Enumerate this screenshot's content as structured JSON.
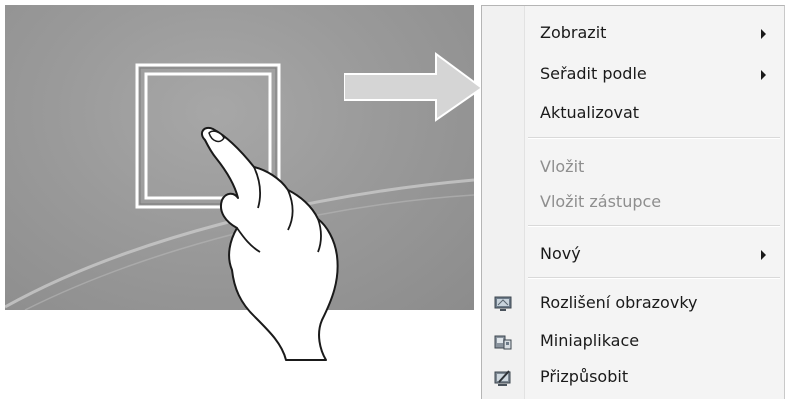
{
  "context_menu": {
    "items": [
      {
        "label": "Zobrazit",
        "submenu": true,
        "enabled": true
      },
      {
        "label": "Seřadit podle",
        "submenu": true,
        "enabled": true
      },
      {
        "label": "Aktualizovat",
        "submenu": false,
        "enabled": true
      },
      {
        "label": "Vložit",
        "submenu": false,
        "enabled": false
      },
      {
        "label": "Vložit zástupce",
        "submenu": false,
        "enabled": false
      },
      {
        "label": "Nový",
        "submenu": true,
        "enabled": true
      },
      {
        "label": "Rozlišení obrazovky",
        "submenu": false,
        "enabled": true,
        "icon": "screen-resolution-icon"
      },
      {
        "label": "Miniaplikace",
        "submenu": false,
        "enabled": true,
        "icon": "gadgets-icon"
      },
      {
        "label": "Přizpůsobit",
        "submenu": false,
        "enabled": true,
        "icon": "personalize-icon"
      }
    ]
  },
  "illustration": {
    "gesture": "press-and-hold",
    "icons": [
      "hand-pointer-icon",
      "selection-square-icon",
      "arrow-right-icon"
    ]
  },
  "colors": {
    "desktop_background": "#9a9a9a",
    "menu_background": "#f4f4f4",
    "disabled_text": "#8e8e8e",
    "arrow_fill": "#d5d5d5"
  }
}
